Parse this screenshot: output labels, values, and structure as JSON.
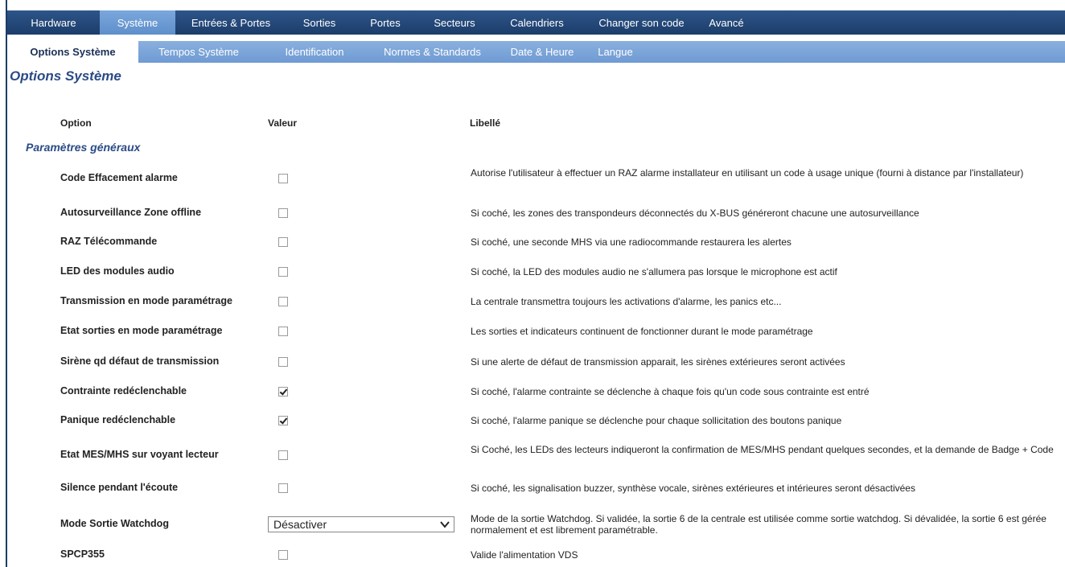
{
  "main_tabs": [
    "Hardware",
    "Système",
    "Entrées & Portes",
    "Sorties",
    "Portes",
    "Secteurs",
    "Calendriers",
    "Changer son code",
    "Avancé"
  ],
  "main_tab_active": "Système",
  "sub_tabs": [
    "Options Système",
    "Tempos Système",
    "Identification",
    "Normes & Standards",
    "Date & Heure",
    "Langue"
  ],
  "sub_tab_active": "Options Système",
  "page_title": "Options Système",
  "columns": {
    "option": "Option",
    "value": "Valeur",
    "label": "Libellé"
  },
  "section_title": "Paramètres généraux",
  "rows": [
    {
      "label": "Code Effacement alarme",
      "type": "checkbox",
      "checked": false,
      "desc": "Autorise l'utilisateur à effectuer un RAZ alarme installateur en utilisant un code à usage unique (fourni à distance par l'installateur)"
    },
    {
      "label": "Autosurveillance Zone offline",
      "type": "checkbox",
      "checked": false,
      "desc": "Si coché, les zones des transpondeurs déconnectés du X-BUS généreront chacune une autosurveillance"
    },
    {
      "label": "RAZ Télécommande",
      "type": "checkbox",
      "checked": false,
      "desc": "Si coché, une seconde MHS via une radiocommande restaurera les alertes"
    },
    {
      "label": "LED des modules audio",
      "type": "checkbox",
      "checked": false,
      "desc": "Si coché, la LED des modules audio ne s'allumera pas lorsque le microphone est actif"
    },
    {
      "label": "Transmission en mode paramétrage",
      "type": "checkbox",
      "checked": false,
      "desc": "La centrale transmettra toujours les activations d'alarme, les panics etc..."
    },
    {
      "label": "Etat sorties en mode paramétrage",
      "type": "checkbox",
      "checked": false,
      "desc": "Les sorties et indicateurs continuent de fonctionner durant le mode paramétrage"
    },
    {
      "label": "Sirène qd défaut de transmission",
      "type": "checkbox",
      "checked": false,
      "desc": "Si une alerte de défaut de transmission apparait, les sirènes extérieures seront activées"
    },
    {
      "label": "Contrainte redéclenchable",
      "type": "checkbox",
      "checked": true,
      "desc": "Si coché, l'alarme contrainte se déclenche à chaque fois qu'un code sous contrainte est entré"
    },
    {
      "label": "Panique redéclenchable",
      "type": "checkbox",
      "checked": true,
      "desc": "Si coché, l'alarme panique se déclenche pour chaque sollicitation des boutons panique"
    },
    {
      "label": "Etat MES/MHS sur voyant lecteur",
      "type": "checkbox",
      "checked": false,
      "desc": "Si Coché, les LEDs des lecteurs indiqueront la confirmation de MES/MHS pendant quelques secondes, et la demande de Badge + Code"
    },
    {
      "label": "Silence pendant l'écoute",
      "type": "checkbox",
      "checked": false,
      "desc": "Si coché, les signalisation buzzer, synthèse vocale, sirènes extérieures et intérieures seront désactivées"
    },
    {
      "label": "Mode Sortie Watchdog",
      "type": "select",
      "value": "Désactiver",
      "desc": "Mode de la sortie Watchdog. Si validée, la sortie 6 de la centrale est utilisée comme sortie watchdog. Si dévalidée, la sortie 6 est gérée normalement et est librement paramétrable."
    },
    {
      "label": "SPCP355",
      "type": "checkbox",
      "checked": false,
      "desc": "Valide l'alimentation VDS"
    }
  ]
}
